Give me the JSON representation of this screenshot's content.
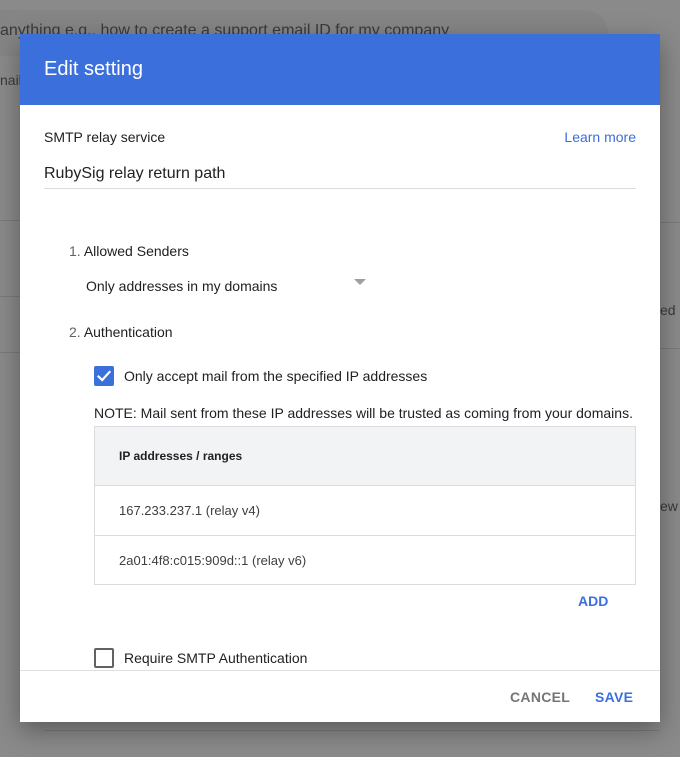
{
  "background": {
    "search_text": "anything e.g., how to create a support email ID for my company",
    "left_snippet": "nail",
    "right_snippet_1": "ed",
    "right_snippet_2": "ew"
  },
  "dialog": {
    "title": "Edit setting",
    "service_label": "SMTP relay service",
    "learn_more": "Learn more",
    "setting_name": "RubySig relay return path",
    "section1": {
      "number": "1.",
      "label": "Allowed Senders"
    },
    "allowed_senders_value": "Only addresses in my domains",
    "section2": {
      "number": "2.",
      "label": "Authentication"
    },
    "ip_only_checkbox": {
      "label": "Only accept mail from the specified IP addresses",
      "checked": true
    },
    "note": "NOTE: Mail sent from these IP addresses will be trusted as coming from your domains.",
    "ip_table": {
      "header": "IP addresses / ranges",
      "rows": [
        "167.233.237.1 (relay v4)",
        "2a01:4f8:c015:909d::1 (relay v6)"
      ]
    },
    "add_label": "ADD",
    "smtp_auth_checkbox": {
      "label": "Require SMTP Authentication",
      "checked": false
    },
    "cancel_label": "CANCEL",
    "save_label": "SAVE"
  },
  "colors": {
    "accent": "#3b6fdc",
    "overlay": "#8a8a8a"
  }
}
